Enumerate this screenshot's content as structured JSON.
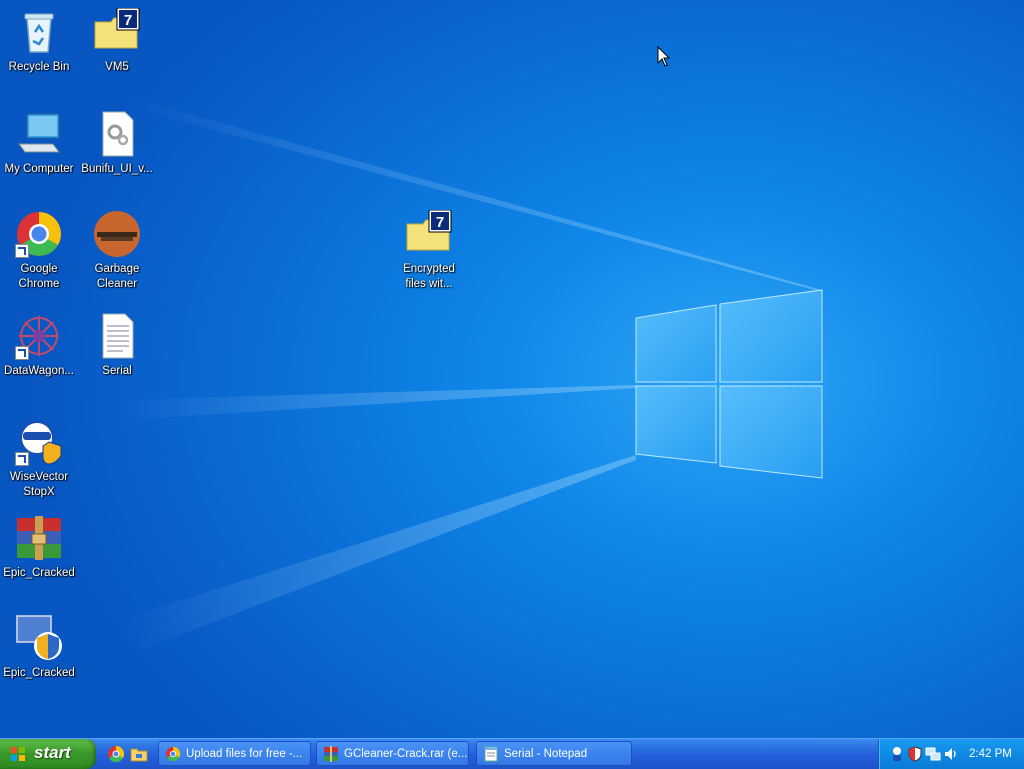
{
  "desktop": {
    "icons": [
      {
        "name": "recycle-bin",
        "label": "Recycle Bin"
      },
      {
        "name": "vm5",
        "label": "VM5"
      },
      {
        "name": "my-computer",
        "label": "My Computer"
      },
      {
        "name": "bunifu-ui",
        "label": "Bunifu_UI_v..."
      },
      {
        "name": "google-chrome",
        "label": "Google\nChrome"
      },
      {
        "name": "garbage-cleaner",
        "label": "Garbage\nCleaner"
      },
      {
        "name": "encrypted-files",
        "label": "Encrypted\nfiles wit..."
      },
      {
        "name": "datawagon",
        "label": "DataWagon..."
      },
      {
        "name": "serial",
        "label": "Serial"
      },
      {
        "name": "wisevector-stopx",
        "label": "WiseVector\nStopX"
      },
      {
        "name": "epic-cracked-rar",
        "label": "Epic_Cracked"
      },
      {
        "name": "epic-cracked-exe",
        "label": "Epic_Cracked"
      }
    ]
  },
  "taskbar": {
    "start_label": "start",
    "quick_launch": [
      "chrome-icon",
      "folder-icon"
    ],
    "tasks": [
      {
        "label": "Upload files for free -...",
        "icon": "chrome-icon"
      },
      {
        "label": "GCleaner-Crack.rar (e...",
        "icon": "winrar-icon"
      },
      {
        "label": "Serial - Notepad",
        "icon": "notepad-icon"
      }
    ],
    "tray_icons": [
      "agent-icon",
      "security-shield-icon",
      "network-icon",
      "volume-icon"
    ],
    "clock": "2:42 PM"
  },
  "colors": {
    "desktop_blue": "#0a6fd6",
    "taskbar_blue": "#245edb",
    "start_green": "#3c9a2c",
    "tray_blue": "#0f8ae4"
  }
}
